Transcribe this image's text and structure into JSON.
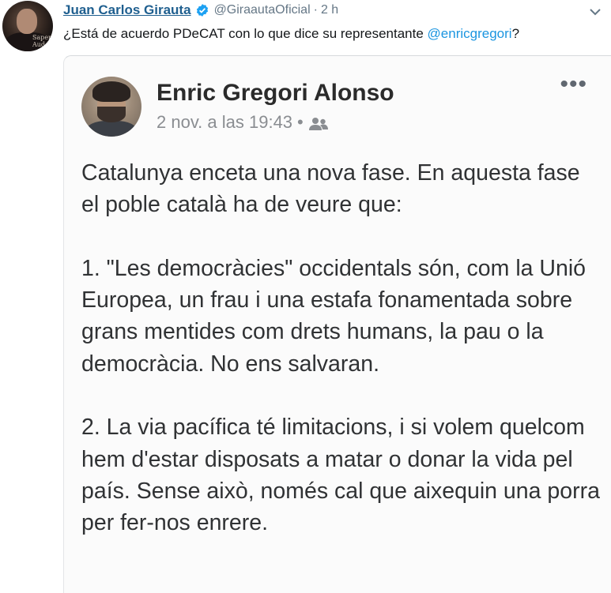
{
  "tweet": {
    "author_name": "Juan Carlos Girauta",
    "handle": "@GiraautaOficial",
    "time": "2 h",
    "separator": "·",
    "text_before": "¿Está de acuerdo PDeCAT con lo que dice su representante ",
    "mention": "@enricgregori",
    "text_after": "?",
    "avatar_mark": "Saper Aud"
  },
  "embedded_post": {
    "author": "Enric Gregori Alonso",
    "date": "2 nov. a las 19:43",
    "meta_dot": "•",
    "more": "•••",
    "paragraphs": [
      "Catalunya enceta una nova fase. En aquesta fase el poble català ha de veure que:",
      "1. \"Les democràcies\" occidentals són, com la Unió Europea, un frau i una estafa fonamentada sobre grans mentides com drets humans, la pau o la democràcia. No ens salvaran.",
      "2. La via pacífica té limitacions, i si volem quelcom hem d'estar disposats a matar o donar la vida pel país. Sense això, només cal que aixequin una porra per fer-nos enrere."
    ]
  },
  "icons": [
    "verified-badge-icon",
    "chevron-down-icon",
    "friends-audience-icon",
    "more-options-icon"
  ],
  "colors": {
    "name_link": "#1f5f8f",
    "mention": "#1b95e0",
    "muted": "#657786",
    "verified": "#1da1f2"
  }
}
